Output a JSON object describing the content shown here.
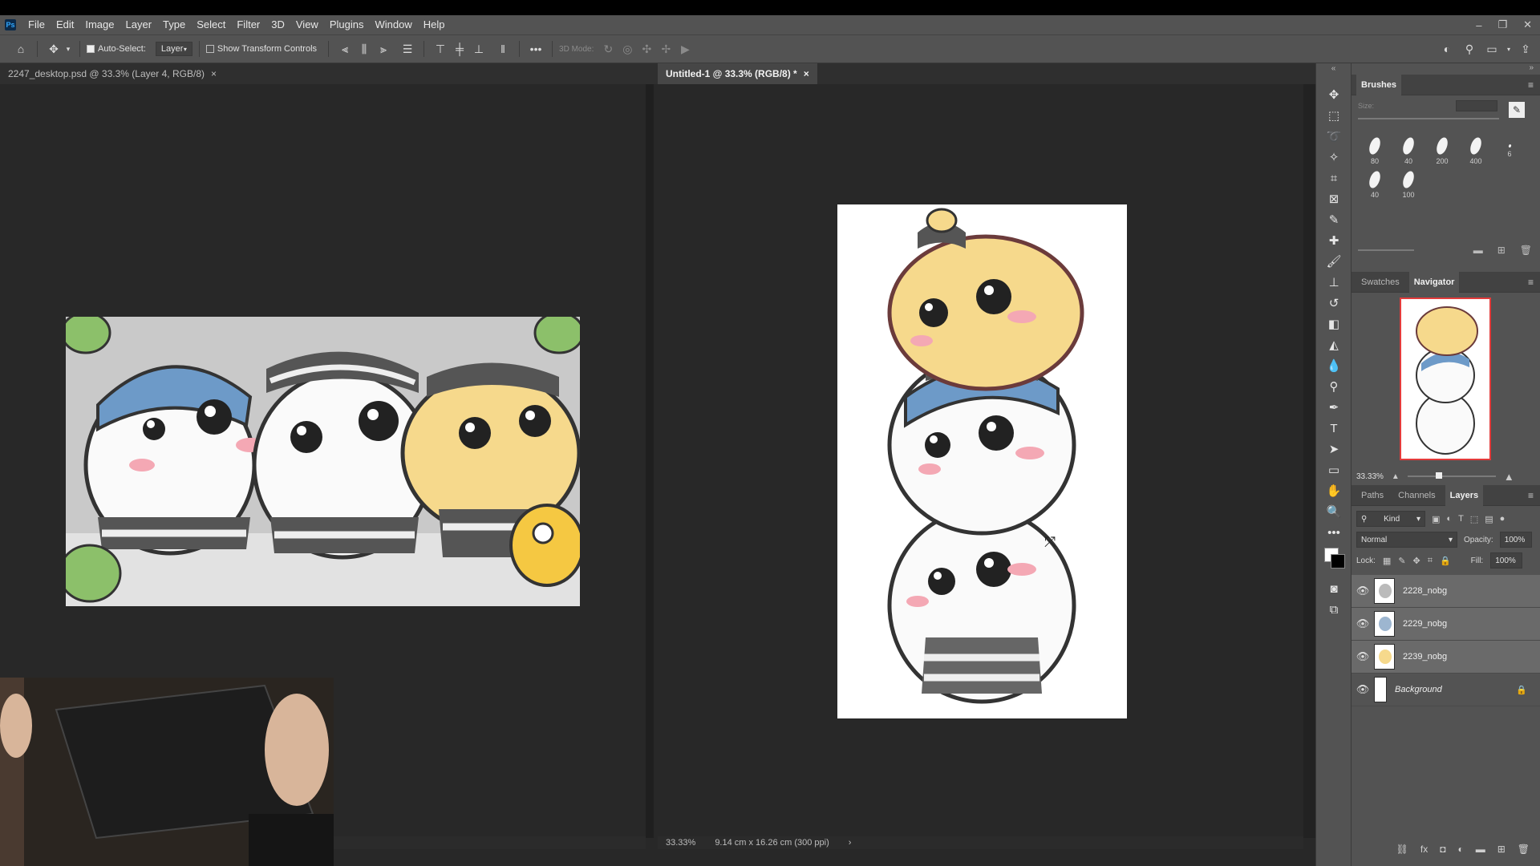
{
  "app": {
    "logo": "Ps"
  },
  "menu": [
    "File",
    "Edit",
    "Image",
    "Layer",
    "Type",
    "Select",
    "Filter",
    "3D",
    "View",
    "Plugins",
    "Window",
    "Help"
  ],
  "window_controls": {
    "minimize": "–",
    "restore": "❐",
    "close": "✕"
  },
  "options_bar": {
    "auto_select_label": "Auto-Select:",
    "auto_select_checked": true,
    "auto_select_target": "Layer",
    "show_transform_label": "Show Transform Controls",
    "show_transform_checked": false,
    "mode_3d_label": "3D Mode:",
    "more": "•••"
  },
  "tabs": {
    "left": {
      "title": "2247_desktop.psd @ 33.3% (Layer 4, RGB/8)",
      "close": "×"
    },
    "right": {
      "title": "Untitled-1 @ 33.3% (RGB/8) *",
      "close": "×"
    }
  },
  "status_bar": {
    "zoom": "33.33%",
    "doc_size": "9.14 cm x 16.26 cm (300 ppi)",
    "arrow": "›"
  },
  "brushes_panel": {
    "title": "Brushes",
    "size_label": "Size:",
    "brush_sizes": [
      "80",
      "40",
      "200",
      "400",
      "6",
      "40",
      "100"
    ]
  },
  "navigator_panel": {
    "tabs": [
      "Swatches",
      "Navigator"
    ],
    "active_tab": "Navigator",
    "zoom": "33.33%"
  },
  "layers_panel": {
    "tabs": [
      "Paths",
      "Channels",
      "Layers"
    ],
    "active_tab": "Layers",
    "filter_kind": "Kind",
    "blend_mode": "Normal",
    "opacity_label": "Opacity:",
    "opacity_value": "100%",
    "lock_label": "Lock:",
    "fill_label": "Fill:",
    "fill_value": "100%",
    "layers": [
      {
        "name": "2228_nobg",
        "visible": true,
        "selected": true
      },
      {
        "name": "2229_nobg",
        "visible": true,
        "selected": true
      },
      {
        "name": "2239_nobg",
        "visible": true,
        "selected": true
      },
      {
        "name": "Background",
        "visible": true,
        "selected": false,
        "locked": true
      }
    ]
  },
  "colors": {
    "ui_bg": "#535353",
    "canvas_bg": "#282828",
    "accent_yellow": "#f6d98c",
    "accent_blue": "#6d9ac8",
    "accent_pink": "#f4a8b4"
  }
}
